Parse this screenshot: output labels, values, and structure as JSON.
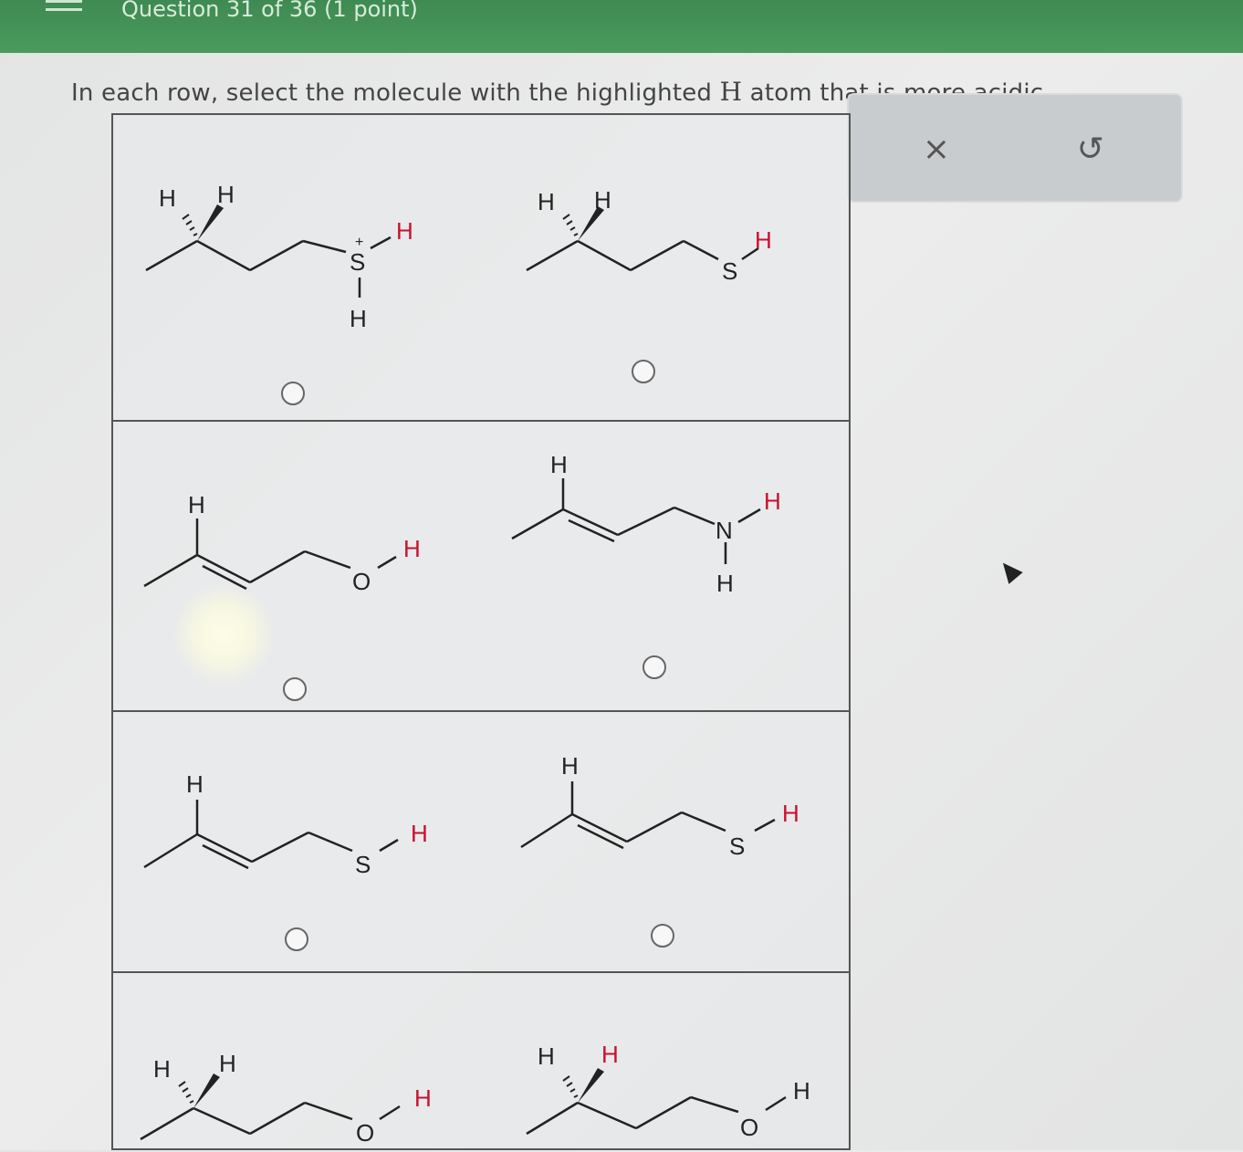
{
  "header": {
    "question_label": "Question 31 of 36 (1 point)"
  },
  "prompt": {
    "before": "In each row, select the molecule with the highlighted ",
    "atom_symbol": "H",
    "after": " atom that is more acidic."
  },
  "toolbar": {
    "close_symbol": "×",
    "undo_symbol": "↺"
  },
  "molecules": {
    "r1a": {
      "heteroatom": "S",
      "charge": "+",
      "acidic_h": "H",
      "extra_h": "H",
      "left_h": "H",
      "right_h": "H"
    },
    "r1b": {
      "heteroatom": "S",
      "acidic_h": "H",
      "left_h": "H",
      "right_h": "H"
    },
    "r2a": {
      "heteroatom": "O",
      "acidic_h": "H",
      "vinyl_h": "H"
    },
    "r2b": {
      "heteroatom": "N",
      "acidic_h": "H",
      "extra_h": "H",
      "vinyl_h": "H"
    },
    "r3a": {
      "heteroatom": "S",
      "acidic_h": "H",
      "vinyl_h": "H"
    },
    "r3b": {
      "heteroatom": "S",
      "acidic_h": "H",
      "vinyl_h": "H"
    },
    "r4a": {
      "heteroatom": "O",
      "acidic_h": "H",
      "left_h": "H",
      "right_h": "H"
    },
    "r4b": {
      "heteroatom": "O",
      "acidic_h": "H",
      "left_h": "H",
      "right_h": "H"
    }
  },
  "colors": {
    "highlight": "#c8102e",
    "header_green": "#4a9a5d"
  }
}
